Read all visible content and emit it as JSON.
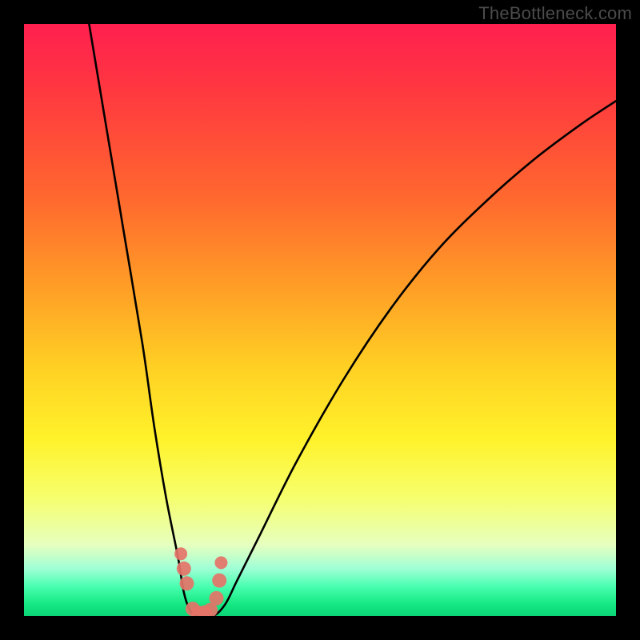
{
  "watermark": "TheBottleneck.com",
  "chart_data": {
    "type": "line",
    "title": "",
    "xlabel": "",
    "ylabel": "",
    "xlim": [
      0,
      100
    ],
    "ylim": [
      0,
      100
    ],
    "series": [
      {
        "name": "bottleneck-curve",
        "x": [
          11,
          14,
          17,
          20,
          22,
          24,
          26,
          27,
          28,
          29,
          30,
          32,
          34,
          36,
          40,
          46,
          54,
          62,
          70,
          78,
          86,
          94,
          100
        ],
        "y": [
          100,
          82,
          64,
          46,
          32,
          20,
          10,
          4,
          1,
          0,
          0,
          0,
          2,
          6,
          14,
          26,
          40,
          52,
          62,
          70,
          77,
          83,
          87
        ]
      }
    ],
    "points": {
      "name": "bottleneck-markers",
      "color": "#e57368",
      "x": [
        26.5,
        27.0,
        27.5,
        28.5,
        29.5,
        30.5,
        31.5,
        32.5,
        33.0,
        33.3
      ],
      "y": [
        10.5,
        8.0,
        5.5,
        1.2,
        0.5,
        0.6,
        1.0,
        3.0,
        6.0,
        9.0
      ]
    },
    "gradient_stops": [
      {
        "pos": 0.0,
        "color": "#ff1f4f"
      },
      {
        "pos": 0.3,
        "color": "#ff6a2e"
      },
      {
        "pos": 0.58,
        "color": "#ffd024"
      },
      {
        "pos": 0.8,
        "color": "#f6ff6d"
      },
      {
        "pos": 0.95,
        "color": "#49ffb0"
      },
      {
        "pos": 1.0,
        "color": "#0bd477"
      }
    ]
  }
}
